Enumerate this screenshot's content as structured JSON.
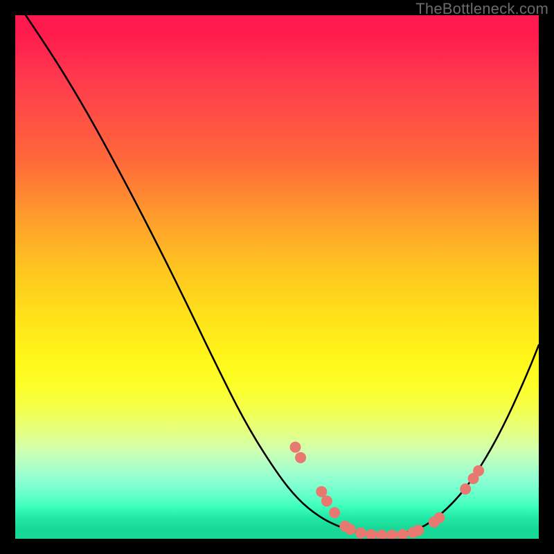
{
  "watermark": "TheBottleneck.com",
  "chart_data": {
    "type": "line",
    "title": "",
    "xlabel": "",
    "ylabel": "",
    "xlim": [
      0,
      100
    ],
    "ylim": [
      0,
      100
    ],
    "grid": false,
    "series": [
      {
        "name": "curve",
        "color": "#000000",
        "x": [
          2,
          8,
          14,
          20,
          26,
          32,
          38,
          44,
          50,
          54,
          58,
          62,
          66,
          70,
          74,
          78,
          82,
          86,
          90,
          94,
          98,
          100
        ],
        "y": [
          100,
          91,
          81,
          70,
          58.5,
          46.5,
          34,
          22,
          12.5,
          7.5,
          4.2,
          2.2,
          1.1,
          0.7,
          0.9,
          2.2,
          5.2,
          9.5,
          15.5,
          23,
          32,
          37
        ]
      }
    ],
    "scatter": {
      "name": "dots",
      "color": "#e87870",
      "radius": 8,
      "points": [
        {
          "x": 53.5,
          "y": 17.5
        },
        {
          "x": 54.5,
          "y": 15.5
        },
        {
          "x": 58.5,
          "y": 9.0
        },
        {
          "x": 59.5,
          "y": 7.2
        },
        {
          "x": 61.0,
          "y": 5.0
        },
        {
          "x": 63.0,
          "y": 2.4
        },
        {
          "x": 64.0,
          "y": 1.8
        },
        {
          "x": 66.0,
          "y": 1.1
        },
        {
          "x": 68.0,
          "y": 0.8
        },
        {
          "x": 70.0,
          "y": 0.7
        },
        {
          "x": 72.0,
          "y": 0.7
        },
        {
          "x": 74.0,
          "y": 0.8
        },
        {
          "x": 76.0,
          "y": 1.2
        },
        {
          "x": 77.0,
          "y": 1.6
        },
        {
          "x": 80.0,
          "y": 3.2
        },
        {
          "x": 81.0,
          "y": 4.0
        },
        {
          "x": 86.0,
          "y": 9.5
        },
        {
          "x": 87.5,
          "y": 11.5
        },
        {
          "x": 88.5,
          "y": 13.0
        }
      ]
    }
  }
}
